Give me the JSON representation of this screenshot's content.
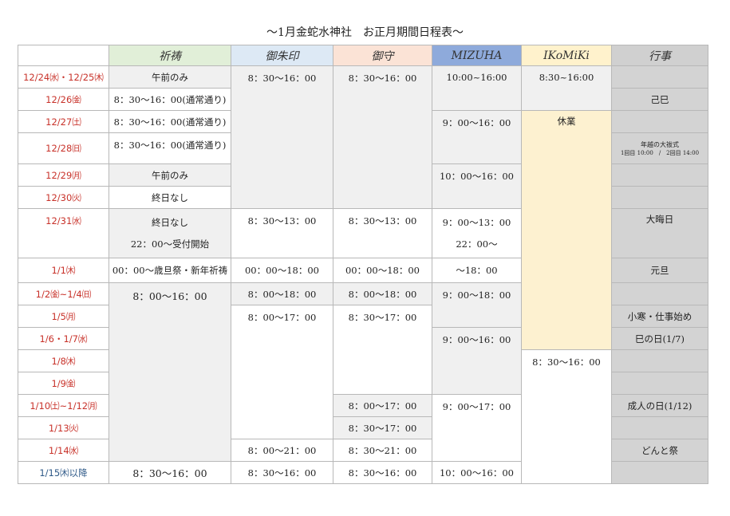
{
  "title": "〜1月金蛇水神社　お正月期間日程表〜",
  "headers": {
    "date": "",
    "kitou": "祈祷",
    "goshuin": "御朱印",
    "omamori": "御守",
    "mizuha": "MIZUHA",
    "ikomiki": "IKoMiKi",
    "gyouji": "行事"
  },
  "header_colors": {
    "kitou": "#e1efd8",
    "goshuin": "#dde9f5",
    "omamori": "#fbe3d6",
    "mizuha": "#8eaadb",
    "ikomiki": "#fff2cc",
    "gyouji": "#d0d0d0"
  },
  "dates": [
    "12/24㈬・12/25㈭",
    "12/26㈮",
    "12/27㈯",
    "12/28㈰",
    "12/29㈪",
    "12/30㈫",
    "12/31㈬",
    "1/1㈭",
    "1/2㈮~1/4㈰",
    "1/5㈪",
    "1/6・1/7㈬",
    "1/8㈭",
    "1/9㈮",
    "1/10㈯~1/12㈪",
    "1/13㈫",
    "1/14㈬",
    "1/15㈭以降"
  ],
  "kitou": {
    "r0": "午前のみ",
    "r1": "8：30～16：00(通常通り)",
    "r2": "8：30～16：00(通常通り)",
    "r3": "8：30～16：00(通常通り)",
    "r4": "午前のみ",
    "r5": "終日なし",
    "r6a": "終日なし",
    "r6b": "22：00～受付開始",
    "r7": "00：00～歳旦祭・新年祈祷",
    "r8": "8：00～16：00",
    "r16": "8：30～16：00"
  },
  "goshuin": {
    "r0": "8：30～16：00",
    "r6": "8：30～13：00",
    "r7": "00：00～18：00",
    "r8": "8：00～18：00",
    "r9": "8：00～17：00",
    "r15": "8：00～21：00",
    "r16": "8：30～16：00"
  },
  "omamori": {
    "r0": "8：30～16：00",
    "r6": "8：30～13：00",
    "r7": "00：00～18：00",
    "r8": "8：00～18：00",
    "r9": "8：30～17：00",
    "r13": "8：00～17：00",
    "r14": "8：30～17：00",
    "r15": "8：30～21：00",
    "r16": "8：30～16：00"
  },
  "mizuha": {
    "r0": "10:00~16:00",
    "r2": "9：00～16：00",
    "r4": "10：00～16：00",
    "r6a": "9：00～13：00",
    "r6b": "22：00～",
    "r7": "～18：00",
    "r8": "9：00～18：00",
    "r10": "9：00～16：00",
    "r13": "9：00～17：00",
    "r16": "10：00～16：00"
  },
  "ikomiki": {
    "r0": "8:30~16:00",
    "r2": "休業",
    "r11": "8：30～16：00"
  },
  "gyouji": {
    "r1": "己巳",
    "r3a": "年越の大祓式",
    "r3b": "1回目 10:00　/　2回目 14:00",
    "r6": "大晦日",
    "r7": "元旦",
    "r9": "小寒・仕事始め",
    "r10": "巳の日(1/7)",
    "r13": "成人の日(1/12)",
    "r15": "どんと祭"
  }
}
